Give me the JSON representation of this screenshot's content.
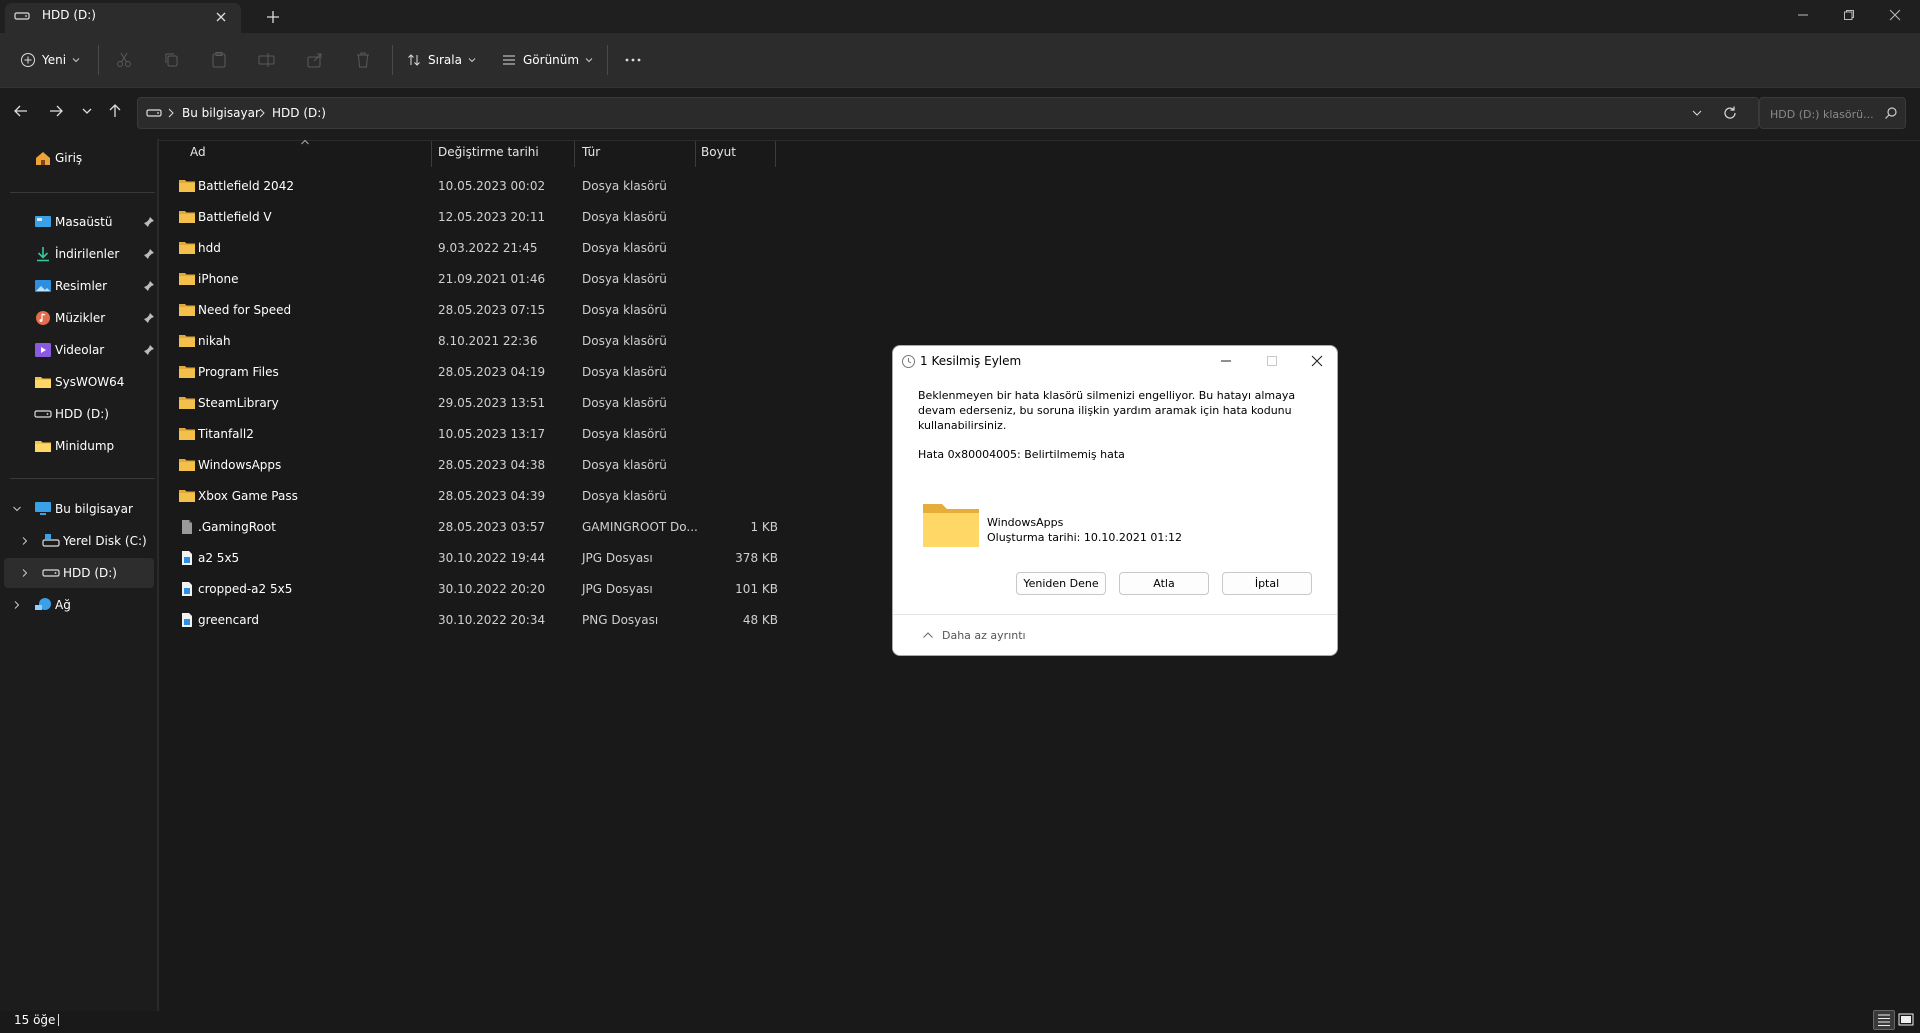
{
  "tab": {
    "title": "HDD (D:)"
  },
  "commandbar": {
    "new_label": "Yeni",
    "sort_label": "Sırala",
    "view_label": "Görünüm"
  },
  "breadcrumb": [
    "Bu bilgisayar",
    "HDD (D:)"
  ],
  "search": {
    "placeholder": "HDD (D:) klasörü..."
  },
  "sidebar": {
    "home": "Giriş",
    "quick": [
      {
        "label": "Masaüstü",
        "icon": "desktop-icon",
        "pinned": true
      },
      {
        "label": "İndirilenler",
        "icon": "download-icon",
        "pinned": true
      },
      {
        "label": "Resimler",
        "icon": "pictures-icon",
        "pinned": true
      },
      {
        "label": "Müzikler",
        "icon": "music-icon",
        "pinned": true
      },
      {
        "label": "Videolar",
        "icon": "videos-icon",
        "pinned": true
      },
      {
        "label": "SysWOW64",
        "icon": "folder-icon",
        "pinned": false
      },
      {
        "label": "HDD (D:)",
        "icon": "drive-icon",
        "pinned": false
      },
      {
        "label": "Minidump",
        "icon": "folder-icon",
        "pinned": false
      }
    ],
    "this_pc": "Bu bilgisayar",
    "drives": [
      "Yerel Disk (C:)",
      "HDD (D:)"
    ],
    "network": "Ağ"
  },
  "columns": {
    "name": "Ad",
    "date": "Değiştirme tarihi",
    "type": "Tür",
    "size": "Boyut"
  },
  "files": [
    {
      "name": "Battlefield 2042",
      "date": "10.05.2023 00:02",
      "type": "Dosya klasörü",
      "size": "",
      "icon": "folder"
    },
    {
      "name": "Battlefield V",
      "date": "12.05.2023 20:11",
      "type": "Dosya klasörü",
      "size": "",
      "icon": "folder"
    },
    {
      "name": "hdd",
      "date": "9.03.2022 21:45",
      "type": "Dosya klasörü",
      "size": "",
      "icon": "folder"
    },
    {
      "name": "iPhone",
      "date": "21.09.2021 01:46",
      "type": "Dosya klasörü",
      "size": "",
      "icon": "folder"
    },
    {
      "name": "Need for Speed",
      "date": "28.05.2023 07:15",
      "type": "Dosya klasörü",
      "size": "",
      "icon": "folder"
    },
    {
      "name": "nikah",
      "date": "8.10.2021 22:36",
      "type": "Dosya klasörü",
      "size": "",
      "icon": "folder"
    },
    {
      "name": "Program Files",
      "date": "28.05.2023 04:19",
      "type": "Dosya klasörü",
      "size": "",
      "icon": "folder"
    },
    {
      "name": "SteamLibrary",
      "date": "29.05.2023 13:51",
      "type": "Dosya klasörü",
      "size": "",
      "icon": "folder"
    },
    {
      "name": "Titanfall2",
      "date": "10.05.2023 13:17",
      "type": "Dosya klasörü",
      "size": "",
      "icon": "folder"
    },
    {
      "name": "WindowsApps",
      "date": "28.05.2023 04:38",
      "type": "Dosya klasörü",
      "size": "",
      "icon": "folder"
    },
    {
      "name": "Xbox Game Pass",
      "date": "28.05.2023 04:39",
      "type": "Dosya klasörü",
      "size": "",
      "icon": "folder"
    },
    {
      "name": ".GamingRoot",
      "date": "28.05.2023 03:57",
      "type": "GAMINGROOT Do...",
      "size": "1 KB",
      "icon": "file"
    },
    {
      "name": "a2 5x5",
      "date": "30.10.2022 19:44",
      "type": "JPG Dosyası",
      "size": "378 KB",
      "icon": "image"
    },
    {
      "name": "cropped-a2 5x5",
      "date": "30.10.2022 20:20",
      "type": "JPG Dosyası",
      "size": "101 KB",
      "icon": "image"
    },
    {
      "name": "greencard",
      "date": "30.10.2022 20:34",
      "type": "PNG Dosyası",
      "size": "48 KB",
      "icon": "image"
    }
  ],
  "status": {
    "count": "15 öğe"
  },
  "dialog": {
    "title": "1 Kesilmiş Eylem",
    "message": "Beklenmeyen bir hata klasörü silmenizi engelliyor. Bu hatayı almaya devam ederseniz, bu soruna ilişkin yardım aramak için hata kodunu kullanabilirsiniz.",
    "error": "Hata 0x80004005: Belirtilmemiş hata",
    "file_name": "WindowsApps",
    "file_created": "Oluşturma tarihi: 10.10.2021 01:12",
    "retry_label": "Yeniden Dene",
    "skip_label": "Atla",
    "cancel_label": "İptal",
    "less_details_label": "Daha az ayrıntı"
  },
  "colors": {
    "background": "#191919",
    "commandbar": "#2c2c2c",
    "folder": "#f4c04c",
    "dialog_bg": "#ffffff"
  }
}
